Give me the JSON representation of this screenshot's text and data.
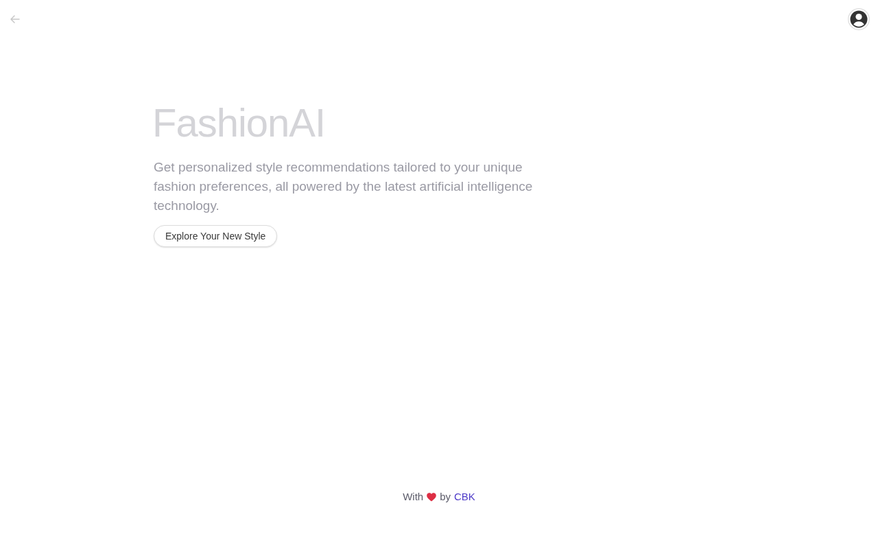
{
  "hero": {
    "title": "FashionAI",
    "description": "Get personalized style recommendations tailored to your unique fashion preferences, all powered by the latest artificial intelligence technology.",
    "button": "Explore Your New Style"
  },
  "footer": {
    "prefix": "With",
    "middle": "by",
    "link": "CBK"
  }
}
